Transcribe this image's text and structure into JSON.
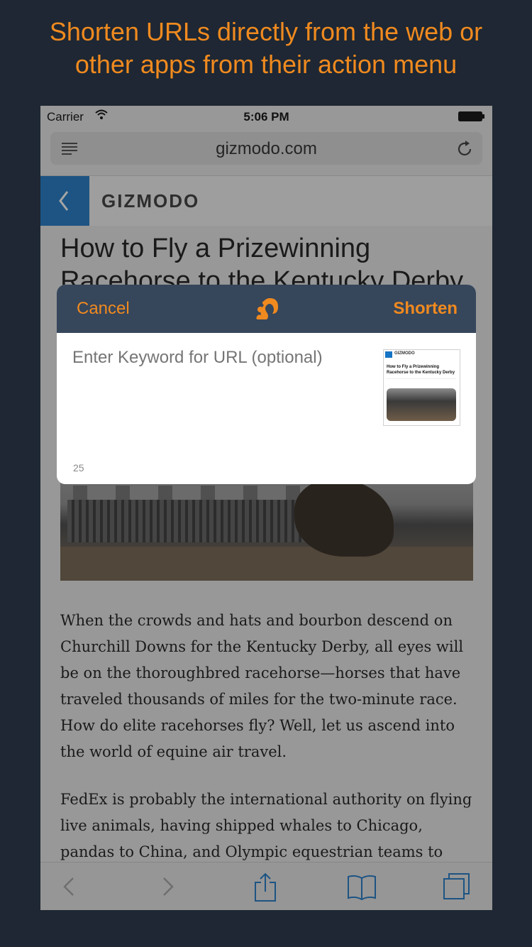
{
  "promo": {
    "line1": "Shorten URLs directly from the web or",
    "line2": "other apps from their action menu"
  },
  "status_bar": {
    "carrier": "Carrier",
    "time": "5:06 PM"
  },
  "browser": {
    "url": "gizmodo.com"
  },
  "site": {
    "logo_text": "GIZMODO"
  },
  "article": {
    "title": "How to Fly a Prizewinning Racehorse to the Kentucky Derby",
    "paragraph1": "When the crowds and hats and bourbon descend on Churchill Downs for the Kentucky Derby, all eyes will be on the thoroughbred racehorse—horses that have traveled thousands of miles for the two-minute race. How do elite racehorses fly? Well, let us ascend into the world of equine air travel.",
    "paragraph2": "FedEx is probably the international authority on flying live animals, having shipped whales to Chicago, pandas to China, and Olympic equestrian teams to London. But"
  },
  "share_sheet": {
    "cancel_label": "Cancel",
    "shorten_label": "Shorten",
    "keyword_placeholder": "Enter Keyword for URL (optional)",
    "char_count": "25",
    "thumbnail": {
      "logo": "GIZMODO",
      "title": "How to Fly a Prizewinning Racehorse to the Kentucky Derby"
    }
  },
  "colors": {
    "accent": "#f08a1f",
    "sheet_header": "#36465b",
    "background": "#1e2733",
    "gizmodo_blue": "#1574c4"
  },
  "icons": {
    "status": [
      "wifi-icon",
      "battery-icon"
    ],
    "urlbar": [
      "reader-icon",
      "reload-icon"
    ],
    "toolbar": [
      "back-icon",
      "forward-icon",
      "share-icon",
      "bookmarks-icon",
      "tabs-icon"
    ],
    "sheet": [
      "squirrel-logo-icon"
    ]
  }
}
